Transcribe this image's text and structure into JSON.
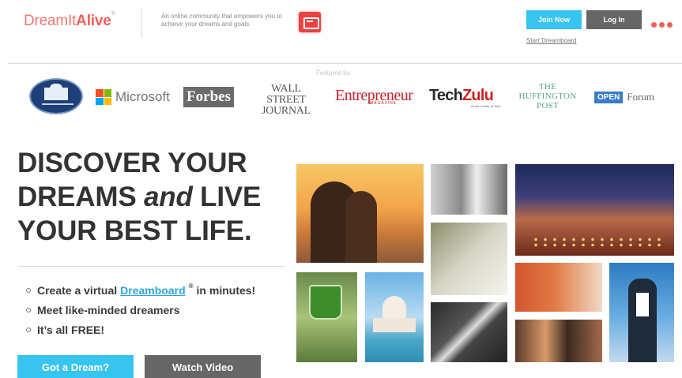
{
  "header": {
    "logo_part1": "DreamIt",
    "logo_part2": "Alive",
    "logo_mark": "®",
    "tagline": "An online community that empowers you to achieve your dreams and goals.",
    "chat_icon": "chat-icon",
    "join_label": "Join Now",
    "login_label": "Log In",
    "start_dreamboard_label": "Start Dreamboard",
    "menu_icon": "more-dots-icon",
    "accent_color": "#f0605a",
    "primary_button_color": "#37c5f0",
    "secondary_button_color": "#666666"
  },
  "featured": {
    "label": "Featured by:",
    "logos": {
      "white_house": "white-house-seal-icon",
      "microsoft": "Microsoft",
      "forbes": "Forbes",
      "wsj_line1": "WALL STREET",
      "wsj_line2": "JOURNAL",
      "entrepreneur": "Entrepreneur",
      "entrepreneur_sub": "MAGAZINE",
      "techzulu_tech": "Tech",
      "techzulu_zulu": "Zulu",
      "techzulu_sub": "At the Center of Tech",
      "huffpost_line1": "THE",
      "huffpost_line2": "HUFFINGTON",
      "huffpost_line3": "POST",
      "open_box": "OPEN",
      "open_text": "Forum"
    }
  },
  "hero": {
    "headline_line1": "DISCOVER YOUR",
    "headline_line2_a": "DREAMS ",
    "headline_line2_b": "and",
    "headline_line2_c": " LIVE",
    "headline_line3": "YOUR BEST LIFE.",
    "bullets": {
      "b1_pre": "Create a virtual",
      "b1_link": "Dreamboard",
      "b1_mark": "®",
      "b1_post": "in minutes!",
      "b2": "Meet like-minded dreamers",
      "b3": "It’s all FREE!"
    },
    "cta_primary": "Got a Dream?",
    "cta_secondary": "Watch Video"
  },
  "collage": {
    "photos": [
      "couple-sunset",
      "couple-kiss",
      "beach-dinner",
      "bride-groom",
      "guitar-player",
      "green-drink",
      "taj-mahal",
      "puzzle-hands",
      "superhero-man",
      "friends-party"
    ]
  }
}
